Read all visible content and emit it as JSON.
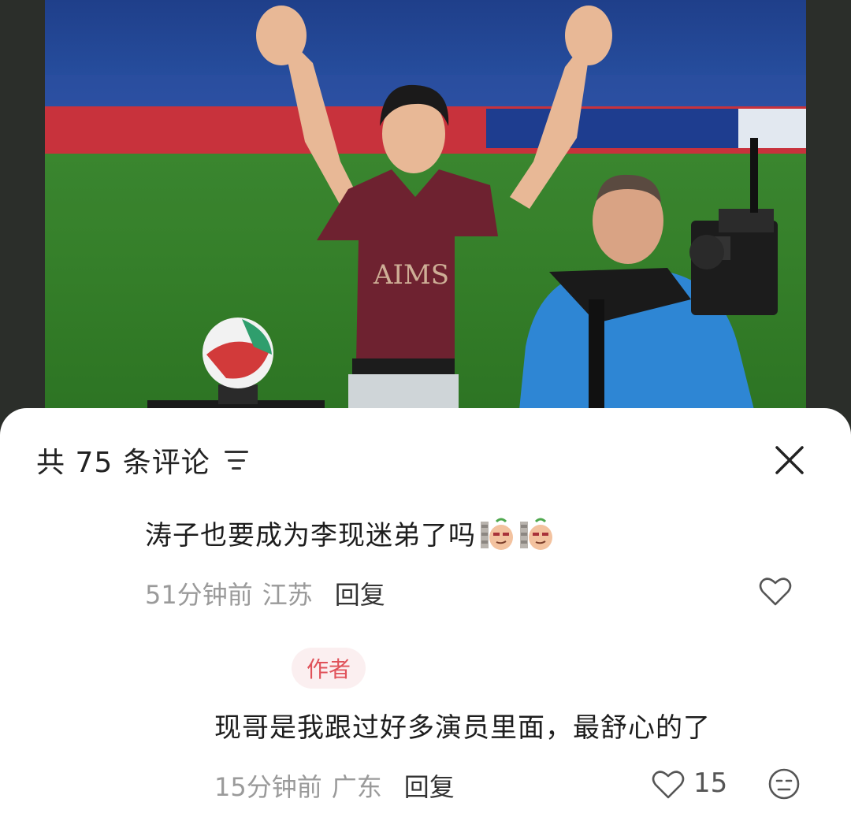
{
  "header": {
    "title": "共 75 条评论",
    "sort_icon": "sort-lines-icon",
    "close_icon": "close-icon"
  },
  "comments": [
    {
      "text": "涛子也要成为李现迷弟了吗",
      "emojis": [
        "smirk-peanut-emoji",
        "smirk-peanut-emoji"
      ],
      "time": "51分钟前",
      "location": "江苏",
      "reply_label": "回复",
      "like_icon": "heart-icon"
    },
    {
      "badge": "作者",
      "text": "现哥是我跟过好多演员里面，最舒心的了",
      "time": "15分钟前",
      "location": "广东",
      "reply_label": "回复",
      "like_icon": "heart-icon",
      "likes": "15",
      "reaction_icon": "meh-face-icon"
    }
  ],
  "colors": {
    "badge_bg": "#fbeff0",
    "badge_text": "#e0525a",
    "meta_text": "#9a9a9a"
  }
}
